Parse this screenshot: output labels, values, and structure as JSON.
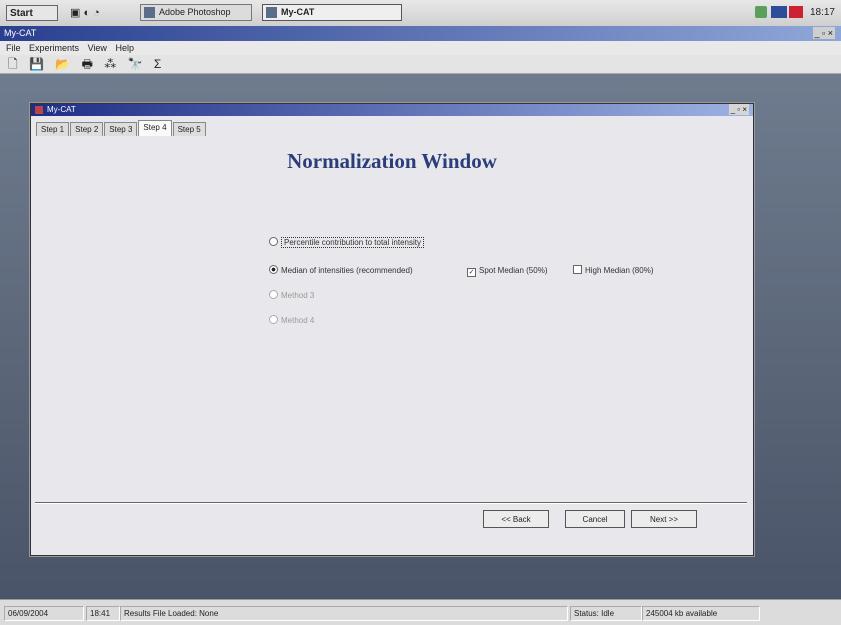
{
  "taskbar": {
    "start_label": "Start",
    "tasks": [
      {
        "label": "Adobe Photoshop"
      },
      {
        "label": "My-CAT"
      }
    ],
    "clock": "18:17"
  },
  "app": {
    "title": "My-CAT",
    "window_controls": "_ ▫ ×",
    "menu": [
      "File",
      "Experiments",
      "View",
      "Help"
    ],
    "toolbar_icons": [
      "new-icon",
      "save-icon",
      "open-icon",
      "print-icon",
      "chart-icon",
      "binoculars-icon",
      "sigma-icon"
    ]
  },
  "child": {
    "title": "My-CAT",
    "window_controls": "_ ▫ ×",
    "tabs": [
      "Step 1",
      "Step 2",
      "Step 3",
      "Step 4",
      "Step 5"
    ],
    "active_tab": 3,
    "heading": "Normalization Window",
    "options": {
      "opt1": "Percentile contribution to total intensity",
      "opt2": "Median of intensities (recommended)",
      "opt2_check1": "Spot Median (50%)",
      "opt2_check2": "High Median (80%)",
      "opt3": "Method 3",
      "opt4": "Method 4"
    },
    "buttons": {
      "back": "<< Back",
      "cancel": "Cancel",
      "next": "Next >>"
    }
  },
  "status": {
    "date": "06/09/2004",
    "time": "18:41",
    "message": "Results File Loaded: None",
    "status_text": "Status: Idle",
    "memory": "245004 kb available"
  }
}
